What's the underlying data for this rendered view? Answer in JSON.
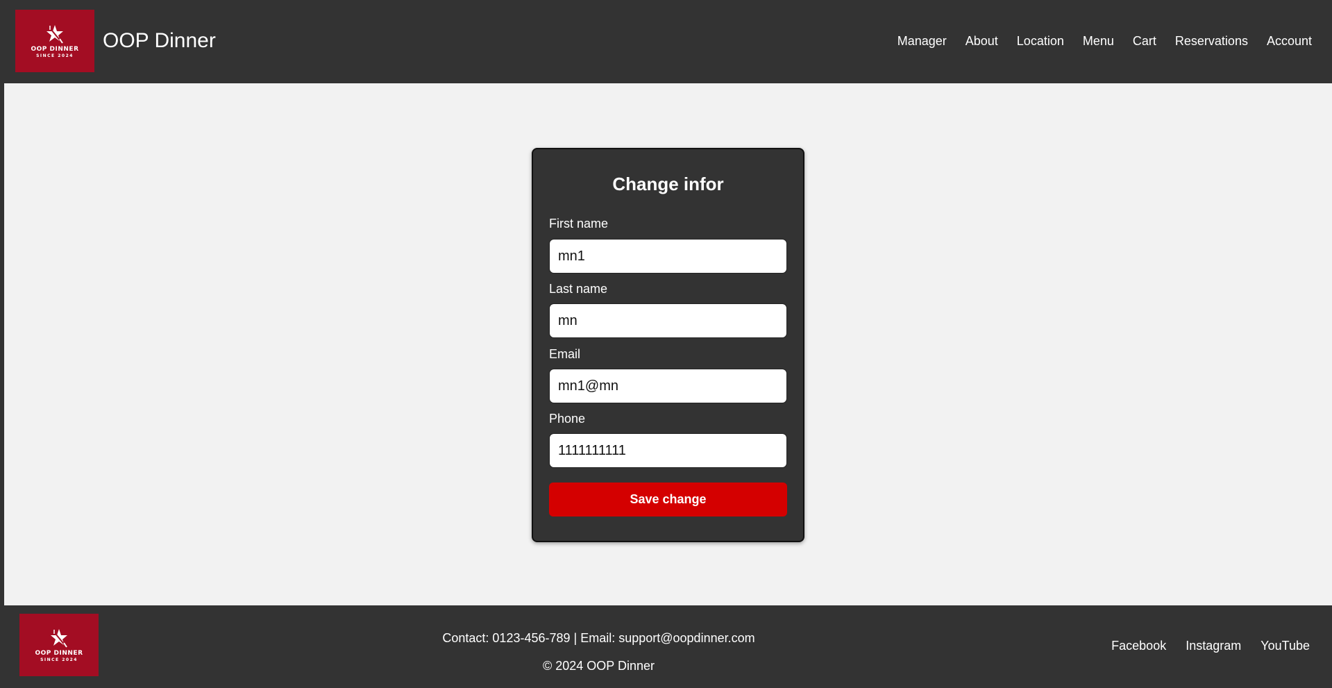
{
  "header": {
    "logo": {
      "name": "OOP DINNER",
      "since": "SINCE 2024",
      "icon": "star-fork-icon"
    },
    "brand": "OOP Dinner",
    "nav": [
      "Manager",
      "About",
      "Location",
      "Menu",
      "Cart",
      "Reservations",
      "Account"
    ]
  },
  "form": {
    "title": "Change infor",
    "fields": [
      {
        "label": "First name",
        "value": "mn1"
      },
      {
        "label": "Last name",
        "value": "mn"
      },
      {
        "label": "Email",
        "value": "mn1@mn"
      },
      {
        "label": "Phone",
        "value": "1111111111"
      }
    ],
    "save_label": "Save change"
  },
  "footer": {
    "logo": {
      "name": "OOP DINNER",
      "since": "SINCE 2024",
      "icon": "star-fork-icon"
    },
    "contact": "Contact: 0123-456-789 | Email: support@oopdinner.com",
    "copyright": "© 2024 OOP Dinner",
    "social": [
      "Facebook",
      "Instagram",
      "YouTube"
    ]
  },
  "colors": {
    "dark": "#333333",
    "page_bg": "#f2f2f2",
    "brand_red": "#a30d23",
    "button_red": "#d40000"
  }
}
